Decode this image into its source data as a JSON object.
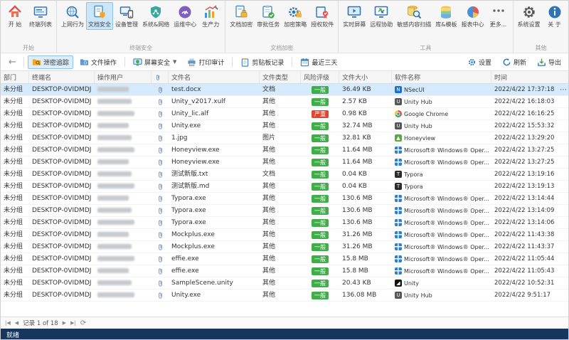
{
  "ribbon": {
    "groups": [
      {
        "label": "开始",
        "items": [
          {
            "label": "开 始",
            "icon": "home-icon"
          },
          {
            "label": "终端列表",
            "icon": "terminal-list-icon"
          }
        ]
      },
      {
        "label": "终端安全",
        "items": [
          {
            "label": "上网行为",
            "icon": "web-behavior-icon"
          },
          {
            "label": "文档安全",
            "icon": "doc-security-icon",
            "selected": true
          },
          {
            "label": "设备管理",
            "icon": "device-mgmt-icon"
          },
          {
            "label": "系统&网络",
            "icon": "system-network-icon"
          },
          {
            "label": "运维中心",
            "icon": "ops-center-icon"
          },
          {
            "label": "生产力",
            "icon": "productivity-icon"
          }
        ]
      },
      {
        "label": "文档加密",
        "items": [
          {
            "label": "文档加密",
            "icon": "doc-encrypt-icon"
          },
          {
            "label": "审批任务",
            "icon": "approval-task-icon"
          },
          {
            "label": "加密策略",
            "icon": "encrypt-policy-icon"
          },
          {
            "label": "授权软件",
            "icon": "licensed-software-icon"
          }
        ]
      },
      {
        "label": "工具",
        "items": [
          {
            "label": "实时屏幕",
            "icon": "realtime-screen-icon"
          },
          {
            "label": "远程协助",
            "icon": "remote-assist-icon"
          },
          {
            "label": "敏感内容扫描",
            "icon": "sensitive-scan-icon"
          },
          {
            "label": "库&模板",
            "icon": "library-template-icon"
          },
          {
            "label": "报表中心",
            "icon": "report-center-icon"
          },
          {
            "label": "更多...",
            "icon": "more-icon"
          }
        ]
      },
      {
        "label": "其他",
        "items": [
          {
            "label": "系统设置",
            "icon": "settings-gear-icon"
          },
          {
            "label": "关 于",
            "icon": "about-info-icon"
          }
        ]
      }
    ]
  },
  "toolbar": {
    "back": {
      "icon": "back-arrow-icon"
    },
    "items": [
      {
        "label": "泄密追踪",
        "icon": "leak-trace-icon",
        "selected": true
      },
      {
        "label": "文件操作",
        "icon": "file-ops-icon"
      },
      {
        "label": "屏幕安全",
        "icon": "screen-security-icon",
        "dropdown": true,
        "sep_before": true
      },
      {
        "label": "打印审计",
        "icon": "print-audit-icon"
      },
      {
        "label": "剪贴板记录",
        "icon": "clipboard-icon",
        "sep_before": true
      },
      {
        "label": "最近三天",
        "icon": "calendar-icon",
        "sep_before": true
      }
    ],
    "right_items": [
      {
        "label": "设置",
        "icon": "gear-icon"
      },
      {
        "label": "刷新",
        "icon": "refresh-icon"
      },
      {
        "label": "导出",
        "icon": "export-icon"
      }
    ]
  },
  "table": {
    "columns": [
      "部门",
      "终端名",
      "操作用户",
      "",
      "文件名",
      "文件类型",
      "风险评级",
      "文件大小",
      "软件名称",
      "时间"
    ],
    "rows": [
      {
        "dept": "未分组",
        "terminal": "DESKTOP-0VIDMDJ",
        "file": "test.docx",
        "type": "文档",
        "risk": "一般",
        "size": "36.49 KB",
        "software": "NSecUI",
        "software_icon": "nsecui-icon",
        "time": "2022/4/22 17:37:18",
        "selected": true
      },
      {
        "dept": "未分组",
        "terminal": "DESKTOP-0VIDMDJ",
        "file": "Unity_v2017.xulf",
        "type": "其他",
        "risk": "一般",
        "size": "2.57 KB",
        "software": "Unity Hub",
        "software_icon": "unity-hub-icon",
        "time": "2022/4/22 16:18:03"
      },
      {
        "dept": "未分组",
        "terminal": "DESKTOP-0VIDMDJ",
        "file": "Unity_lic.alf",
        "type": "其他",
        "risk": "严重",
        "size": "0.98 KB",
        "software": "Google Chrome",
        "software_icon": "chrome-icon",
        "time": "2022/4/22 16:16:25"
      },
      {
        "dept": "未分组",
        "terminal": "DESKTOP-0VIDMDJ",
        "file": "Unity.exe",
        "type": "其他",
        "risk": "一般",
        "size": "32.74 MB",
        "software": "Unity Hub",
        "software_icon": "unity-hub-icon",
        "time": "2022/4/22 15:53:32"
      },
      {
        "dept": "未分组",
        "terminal": "DESKTOP-0VIDMDJ",
        "file": "1.jpg",
        "type": "图片",
        "risk": "一般",
        "size": "32.81 KB",
        "software": "Honeyview",
        "software_icon": "honeyview-icon",
        "time": "2022/4/22 13:29:20"
      },
      {
        "dept": "未分组",
        "terminal": "DESKTOP-0VIDMDJ",
        "file": "Honeyview.exe",
        "type": "其他",
        "risk": "一般",
        "size": "11.64 MB",
        "software": "Microsoft® Windows® Oper...",
        "software_icon": "windows-icon",
        "time": "2022/4/22 13:27:25"
      },
      {
        "dept": "未分组",
        "terminal": "DESKTOP-0VIDMDJ",
        "file": "Honeyview.exe",
        "type": "其他",
        "risk": "一般",
        "size": "11.64 MB",
        "software": "Microsoft® Windows® Oper...",
        "software_icon": "windows-icon",
        "time": "2022/4/22 13:27:25"
      },
      {
        "dept": "未分组",
        "terminal": "DESKTOP-0VIDMDJ",
        "file": "测试新版.txt",
        "type": "文档",
        "risk": "一般",
        "size": "0.04 KB",
        "software": "Typora",
        "software_icon": "typora-icon",
        "time": "2022/4/22 13:19:16"
      },
      {
        "dept": "未分组",
        "terminal": "DESKTOP-0VIDMDJ",
        "file": "测试新版.md",
        "type": "其他",
        "risk": "一般",
        "size": "0.04 KB",
        "software": "Typora",
        "software_icon": "typora-icon",
        "time": "2022/4/22 13:19:13"
      },
      {
        "dept": "未分组",
        "terminal": "DESKTOP-0VIDMDJ",
        "file": "Typora.exe",
        "type": "其他",
        "risk": "一般",
        "size": "130.6 MB",
        "software": "Microsoft® Windows® Oper...",
        "software_icon": "windows-icon",
        "time": "2022/4/22 13:14:44"
      },
      {
        "dept": "未分组",
        "terminal": "DESKTOP-0VIDMDJ",
        "file": "Typora.exe",
        "type": "其他",
        "risk": "一般",
        "size": "130.6 MB",
        "software": "Microsoft® Windows® Oper...",
        "software_icon": "windows-icon",
        "time": "2022/4/22 13:14:09"
      },
      {
        "dept": "未分组",
        "terminal": "DESKTOP-0VIDMDJ",
        "file": "Typora.exe",
        "type": "其他",
        "risk": "一般",
        "size": "130.6 MB",
        "software": "Microsoft® Windows® Oper...",
        "software_icon": "windows-icon",
        "time": "2022/4/22 13:14:06"
      },
      {
        "dept": "未分组",
        "terminal": "DESKTOP-0VIDMDJ",
        "file": "Mockplus.exe",
        "type": "其他",
        "risk": "一般",
        "size": "31.26 MB",
        "software": "Microsoft® Windows® Oper...",
        "software_icon": "windows-icon",
        "time": "2022/4/22 11:43:38"
      },
      {
        "dept": "未分组",
        "terminal": "DESKTOP-0VIDMDJ",
        "file": "Mockplus.exe",
        "type": "其他",
        "risk": "一般",
        "size": "31.26 MB",
        "software": "Microsoft® Windows® Oper...",
        "software_icon": "windows-icon",
        "time": "2022/4/22 11:43:37"
      },
      {
        "dept": "未分组",
        "terminal": "DESKTOP-0VIDMDJ",
        "file": "effie.exe",
        "type": "其他",
        "risk": "一般",
        "size": "15.8 MB",
        "software": "Microsoft® Windows® Oper...",
        "software_icon": "windows-icon",
        "time": "2022/4/22 11:05:44"
      },
      {
        "dept": "未分组",
        "terminal": "DESKTOP-0VIDMDJ",
        "file": "effie.exe",
        "type": "其他",
        "risk": "一般",
        "size": "15.8 MB",
        "software": "Microsoft® Windows® Oper...",
        "software_icon": "windows-icon",
        "time": "2022/4/22 11:05:43"
      },
      {
        "dept": "未分组",
        "terminal": "DESKTOP-0VIDMDJ",
        "file": "SampleScene.unity",
        "type": "其他",
        "risk": "一般",
        "size": "20.43 KB",
        "software": "Unity",
        "software_icon": "unity-icon",
        "time": "2022/4/22 10:52:31"
      },
      {
        "dept": "未分组",
        "terminal": "DESKTOP-0VIDMDJ",
        "file": "Unity.exe",
        "type": "其他",
        "risk": "一般",
        "size": "136.08 MB",
        "software": "Unity Hub",
        "software_icon": "unity-hub-icon",
        "time": "2022/4/22 9:51:17"
      }
    ]
  },
  "pagination": {
    "label": "记录 1 of 18"
  },
  "statusbar": {
    "text": "就绪"
  },
  "colors": {
    "accent": "#2e74b5",
    "selected_row": "#d5eafc",
    "ribbon_selected": "#cbe5f9",
    "risk_general": "#3fae49",
    "risk_severe": "#e0452f",
    "statusbar_bg": "#17365d"
  }
}
